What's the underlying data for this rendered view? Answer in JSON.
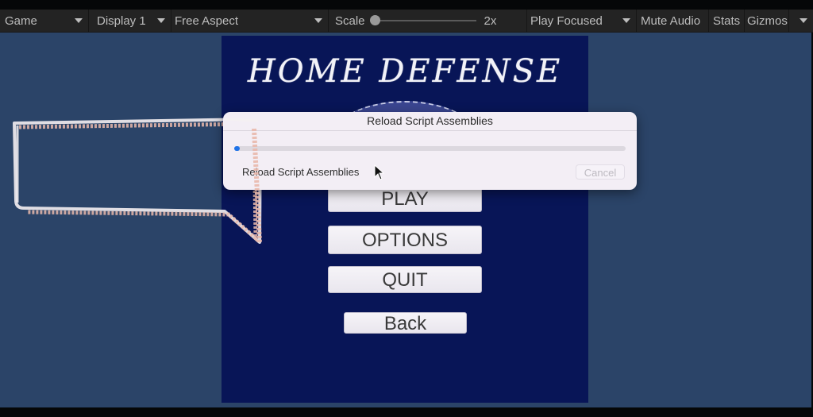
{
  "toolbar": {
    "view_tab": "Game",
    "display": "Display 1",
    "aspect": "Free Aspect",
    "scale_label": "Scale",
    "scale_value": "2x",
    "scale_slider_fraction": 0.0,
    "play_mode": "Play Focused",
    "mute_audio": "Mute Audio",
    "stats": "Stats",
    "gizmos": "Gizmos"
  },
  "game": {
    "title": "HOME DEFENSE",
    "buttons": {
      "play": "PLAY",
      "options": "OPTIONS",
      "quit": "QUIT",
      "back": "Back"
    }
  },
  "dialog": {
    "title": "Reload Script Assemblies",
    "status": "Reload Script Assemblies",
    "progress_fraction": 0.01,
    "cancel": "Cancel"
  },
  "colors": {
    "toolbar_bg": "#232323",
    "game_view_bg": "#2b4468",
    "canvas_bg": "#081557",
    "progress_accent": "#1f73e8"
  }
}
